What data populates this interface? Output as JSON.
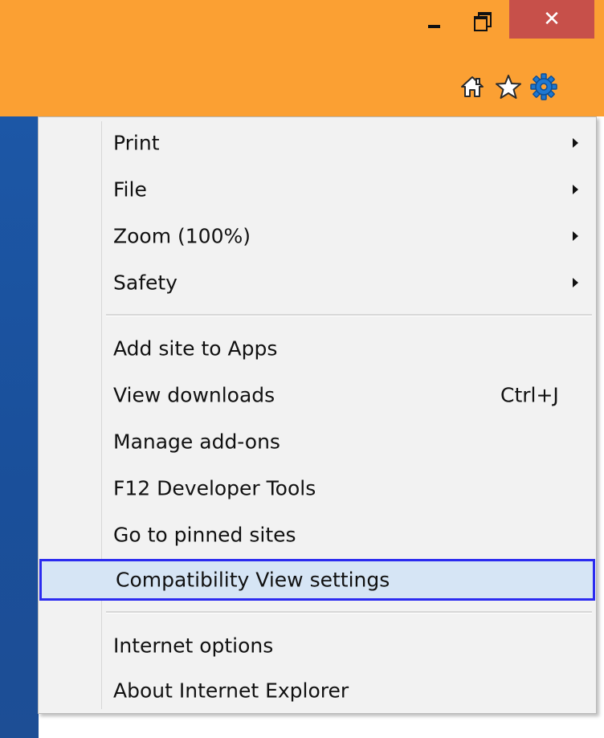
{
  "window": {
    "caption_buttons": {
      "minimize_icon": "minimize-icon",
      "restore_icon": "restore-icon",
      "close_glyph": "✕"
    },
    "toolbar_icons": [
      "home-icon",
      "favorites-star-icon",
      "tools-gear-icon"
    ],
    "chrome_color": "#fba033",
    "close_color": "#c7504a"
  },
  "menu": {
    "group1": [
      {
        "label": "Print",
        "has_submenu": true
      },
      {
        "label": "File",
        "has_submenu": true
      },
      {
        "label": "Zoom (100%)",
        "has_submenu": true
      },
      {
        "label": "Safety",
        "has_submenu": true
      }
    ],
    "group2": [
      {
        "label": "Add site to Apps"
      },
      {
        "label": "View downloads",
        "shortcut": "Ctrl+J"
      },
      {
        "label": "Manage add-ons"
      },
      {
        "label": "F12 Developer Tools"
      },
      {
        "label": "Go to pinned sites"
      },
      {
        "label": "Compatibility View settings",
        "highlighted": true
      }
    ],
    "group3": [
      {
        "label": "Internet options"
      },
      {
        "label": "About Internet Explorer"
      }
    ],
    "highlight_color": "#d6e5f5",
    "highlight_border": "#2b2bf0"
  }
}
